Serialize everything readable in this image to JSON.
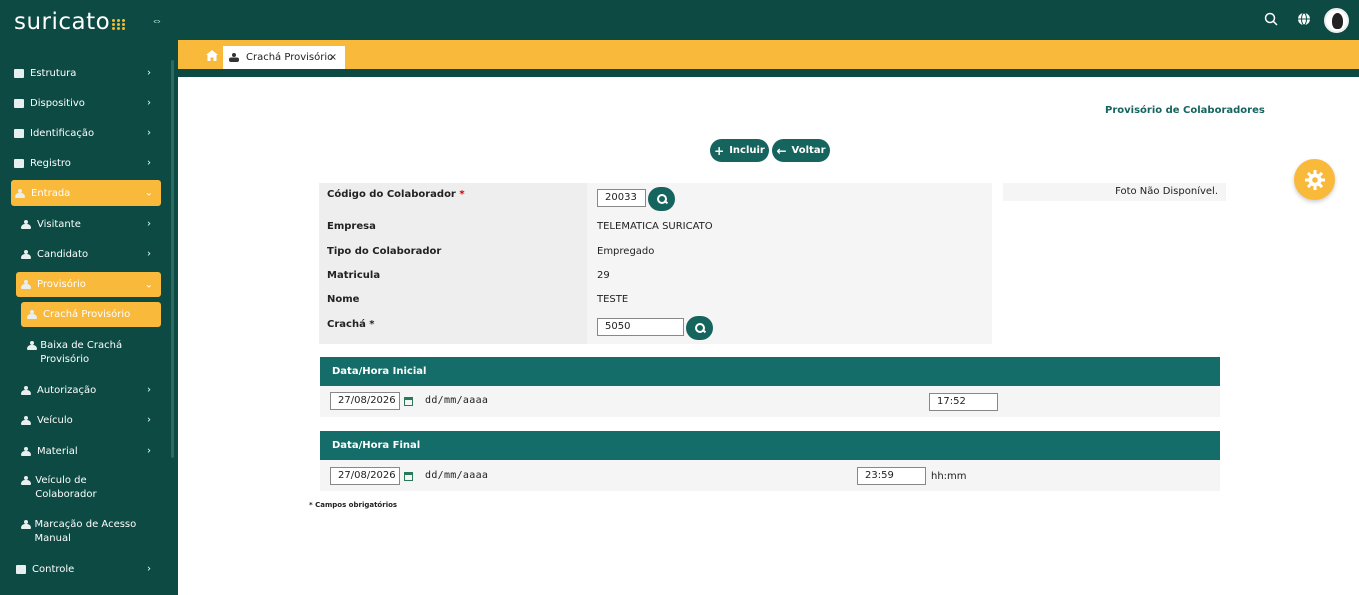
{
  "app": {
    "logo": "suricato"
  },
  "colors": {
    "primary_dark": "#0c4a43",
    "accent": "#f9b93a",
    "teal": "#16645e"
  },
  "sidebar": {
    "items": [
      {
        "label": "Estrutura",
        "icon": "building-icon"
      },
      {
        "label": "Dispositivo",
        "icon": "device-icon"
      },
      {
        "label": "Identificação",
        "icon": "id-card-icon"
      },
      {
        "label": "Registro",
        "icon": "register-icon"
      },
      {
        "label": "Entrada",
        "icon": "person-icon"
      },
      {
        "label": "Visitante",
        "icon": "person-icon"
      },
      {
        "label": "Candidato",
        "icon": "person-icon"
      },
      {
        "label": "Provisório",
        "icon": "person-icon"
      },
      {
        "label": "Crachá Provisório",
        "icon": "person-icon"
      },
      {
        "label": "Baixa de Crachá Provisório",
        "icon": "person-icon"
      },
      {
        "label": "Autorização",
        "icon": "person-icon"
      },
      {
        "label": "Veículo",
        "icon": "person-icon"
      },
      {
        "label": "Material",
        "icon": "person-icon"
      },
      {
        "label": "Veículo de Colaborador",
        "icon": "person-icon"
      },
      {
        "label": "Marcação de Acesso Manual",
        "icon": "person-icon"
      },
      {
        "label": "Controle",
        "icon": "puzzle-icon"
      }
    ]
  },
  "tabs": [
    {
      "label": "Crachá Provisório",
      "close": "×"
    }
  ],
  "header": {
    "section_link": "Provisório de Colaboradores"
  },
  "actions": {
    "include_label": "Incluir",
    "back_label": "Voltar"
  },
  "form": {
    "codigo_label": "Código do Colaborador",
    "required_mark": "*",
    "codigo_value": "20033",
    "empresa_label": "Empresa",
    "empresa_value": "TELEMATICA SURICATO",
    "tipo_label": "Tipo do Colaborador",
    "tipo_value": "Empregado",
    "matricula_label": "Matricula",
    "matricula_value": "29",
    "nome_label": "Nome",
    "nome_value": "TESTE",
    "cracha_label": "Crachá *",
    "cracha_value": "5050",
    "photo_text": "Foto Não Disponível."
  },
  "inicial": {
    "title": "Data/Hora Inicial",
    "date": "27/08/2026",
    "date_format": "dd/mm/aaaa",
    "time": "17:52"
  },
  "final": {
    "title": "Data/Hora Final",
    "date": "27/08/2026",
    "date_format": "dd/mm/aaaa",
    "time": "23:59",
    "time_format": "hh:mm"
  },
  "footnote": "* Campos obrigatórios"
}
